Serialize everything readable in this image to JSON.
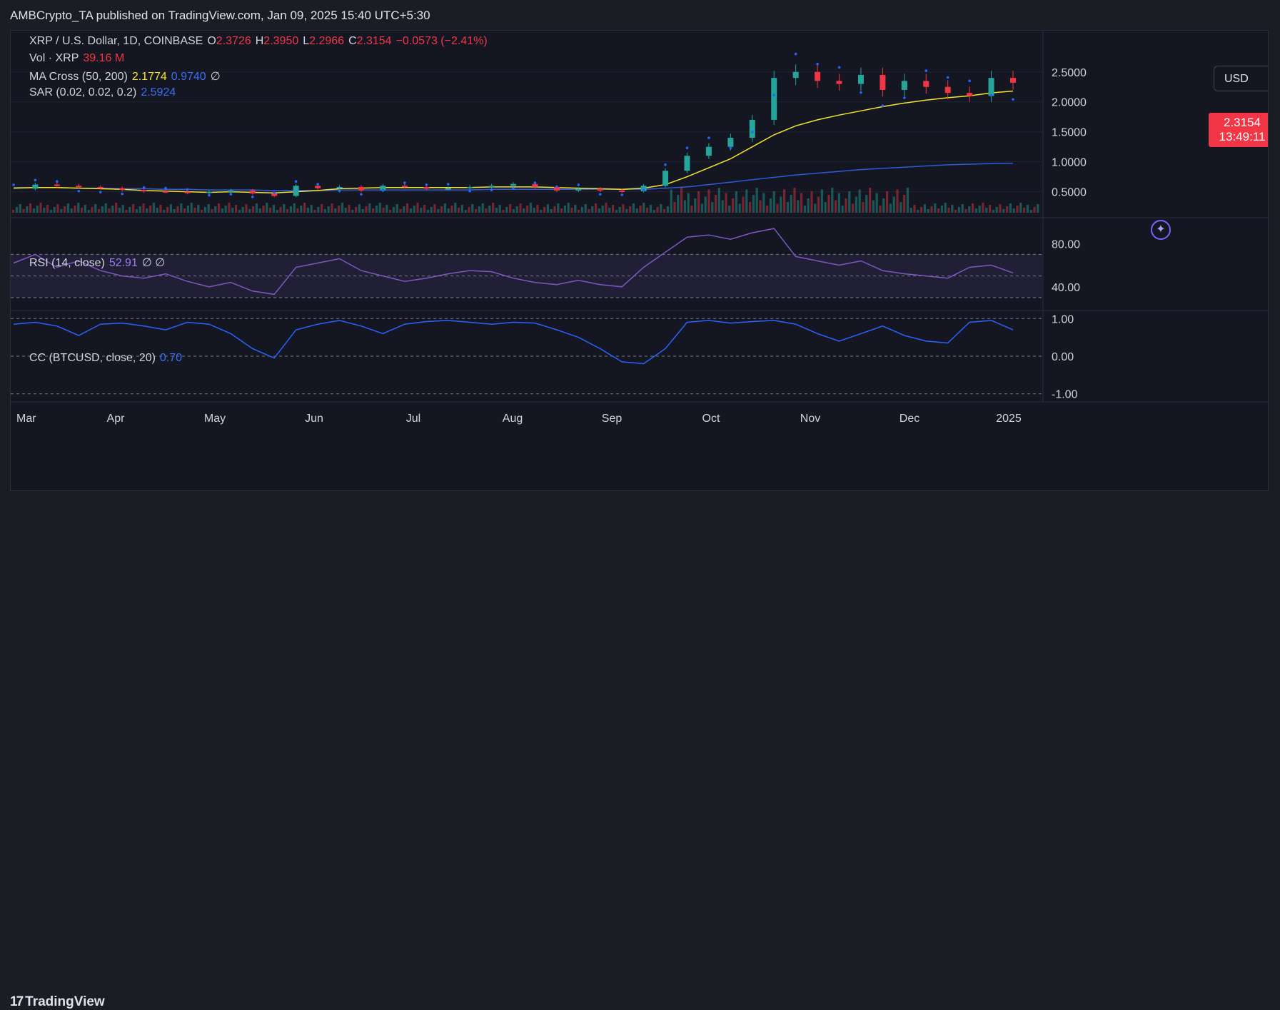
{
  "header": {
    "publisher": "AMBCrypto_TA published on TradingView.com, Jan 09, 2025 15:40 UTC+5:30"
  },
  "legend": {
    "symbol": "XRP / U.S. Dollar, 1D, COINBASE",
    "o_label": "O",
    "o_value": "2.3726",
    "h_label": "H",
    "h_value": "2.3950",
    "l_label": "L",
    "l_value": "2.2966",
    "c_label": "C",
    "c_value": "2.3154",
    "change": "−0.0573 (−2.41%)",
    "vol_label": "Vol · XRP",
    "vol_value": "39.16 M",
    "ma_label": "MA Cross (50, 200)",
    "ma_fast": "2.1774",
    "ma_slow": "0.9740",
    "ma_extra": "∅",
    "sar_label": "SAR (0.02, 0.02, 0.2)",
    "sar_value": "2.5924",
    "rsi_label": "RSI (14, close)",
    "rsi_value": "52.91",
    "rsi_extra": "∅ ∅",
    "cc_label": "CC (BTCUSD, close, 20)",
    "cc_value": "0.70"
  },
  "currency_button": "USD",
  "price_tag": {
    "price": "2.3154",
    "countdown": "13:49:11"
  },
  "footer": {
    "logo_mark": "17",
    "logo_text": "TradingView"
  },
  "colors": {
    "up": "#26a69a",
    "down": "#f23645",
    "ma_fast": "#f5e52a",
    "ma_slow": "#2f5bd9",
    "sar": "#2962ff",
    "rsi": "#7e57c2",
    "cc": "#2962ff",
    "bg": "#141722"
  },
  "chart_data": {
    "type": "line",
    "title": "XRP / U.S. Dollar, 1D, COINBASE",
    "x": [
      "Mar",
      "Apr",
      "May",
      "Jun",
      "Jul",
      "Aug",
      "Sep",
      "Oct",
      "Nov",
      "Dec",
      "2025"
    ],
    "price_axis": {
      "ticks": [
        "2.5000",
        "2.0000",
        "1.5000",
        "1.0000",
        "0.5000"
      ],
      "ylim": [
        0.15,
        2.95
      ]
    },
    "rsi_axis": {
      "ticks": [
        "80.00",
        "40.00"
      ],
      "ylim": [
        22,
        100
      ],
      "bands": [
        70,
        30
      ]
    },
    "cc_axis": {
      "ticks": [
        "1.00",
        "0.00",
        "-1.00"
      ],
      "ylim": [
        -1.1,
        1.1
      ]
    },
    "series": [
      {
        "name": "XRP close",
        "values": [
          0.55,
          0.62,
          0.6,
          0.58,
          0.56,
          0.53,
          0.51,
          0.5,
          0.48,
          0.5,
          0.52,
          0.47,
          0.43,
          0.6,
          0.56,
          0.58,
          0.52,
          0.6,
          0.58,
          0.55,
          0.56,
          0.58,
          0.6,
          0.63,
          0.58,
          0.52,
          0.55,
          0.52,
          0.51,
          0.6,
          0.85,
          1.1,
          1.25,
          1.4,
          1.7,
          2.4,
          2.5,
          2.35,
          2.3,
          2.45,
          2.2,
          2.35,
          2.25,
          2.15,
          2.1,
          2.4,
          2.32
        ]
      },
      {
        "name": "MA 50",
        "values": [
          0.56,
          0.57,
          0.57,
          0.56,
          0.55,
          0.54,
          0.52,
          0.51,
          0.5,
          0.49,
          0.5,
          0.49,
          0.48,
          0.5,
          0.52,
          0.55,
          0.56,
          0.57,
          0.57,
          0.57,
          0.57,
          0.57,
          0.58,
          0.58,
          0.58,
          0.57,
          0.56,
          0.55,
          0.54,
          0.56,
          0.62,
          0.75,
          0.9,
          1.05,
          1.25,
          1.45,
          1.6,
          1.7,
          1.78,
          1.85,
          1.92,
          1.98,
          2.03,
          2.07,
          2.1,
          2.15,
          2.18
        ]
      },
      {
        "name": "MA 200",
        "values": [
          0.57,
          0.57,
          0.57,
          0.56,
          0.56,
          0.55,
          0.55,
          0.54,
          0.54,
          0.53,
          0.53,
          0.53,
          0.52,
          0.52,
          0.52,
          0.53,
          0.53,
          0.53,
          0.53,
          0.53,
          0.53,
          0.53,
          0.54,
          0.54,
          0.54,
          0.54,
          0.54,
          0.54,
          0.54,
          0.54,
          0.56,
          0.58,
          0.62,
          0.66,
          0.7,
          0.74,
          0.78,
          0.81,
          0.84,
          0.87,
          0.89,
          0.91,
          0.93,
          0.95,
          0.96,
          0.97,
          0.974
        ]
      },
      {
        "name": "RSI",
        "values": [
          62,
          70,
          58,
          64,
          55,
          50,
          48,
          52,
          45,
          40,
          44,
          36,
          33,
          58,
          62,
          66,
          55,
          50,
          45,
          48,
          52,
          55,
          54,
          48,
          44,
          42,
          46,
          42,
          40,
          58,
          72,
          86,
          88,
          84,
          90,
          94,
          68,
          64,
          60,
          64,
          55,
          52,
          50,
          48,
          58,
          60,
          52.9
        ]
      },
      {
        "name": "CC",
        "values": [
          0.85,
          0.9,
          0.8,
          0.55,
          0.85,
          0.88,
          0.8,
          0.7,
          0.9,
          0.85,
          0.6,
          0.2,
          -0.05,
          0.7,
          0.85,
          0.95,
          0.8,
          0.6,
          0.85,
          0.92,
          0.95,
          0.9,
          0.85,
          0.9,
          0.88,
          0.7,
          0.5,
          0.2,
          -0.15,
          -0.2,
          0.2,
          0.9,
          0.95,
          0.88,
          0.92,
          0.95,
          0.85,
          0.6,
          0.4,
          0.6,
          0.8,
          0.55,
          0.4,
          0.35,
          0.9,
          0.95,
          0.7
        ]
      }
    ]
  }
}
